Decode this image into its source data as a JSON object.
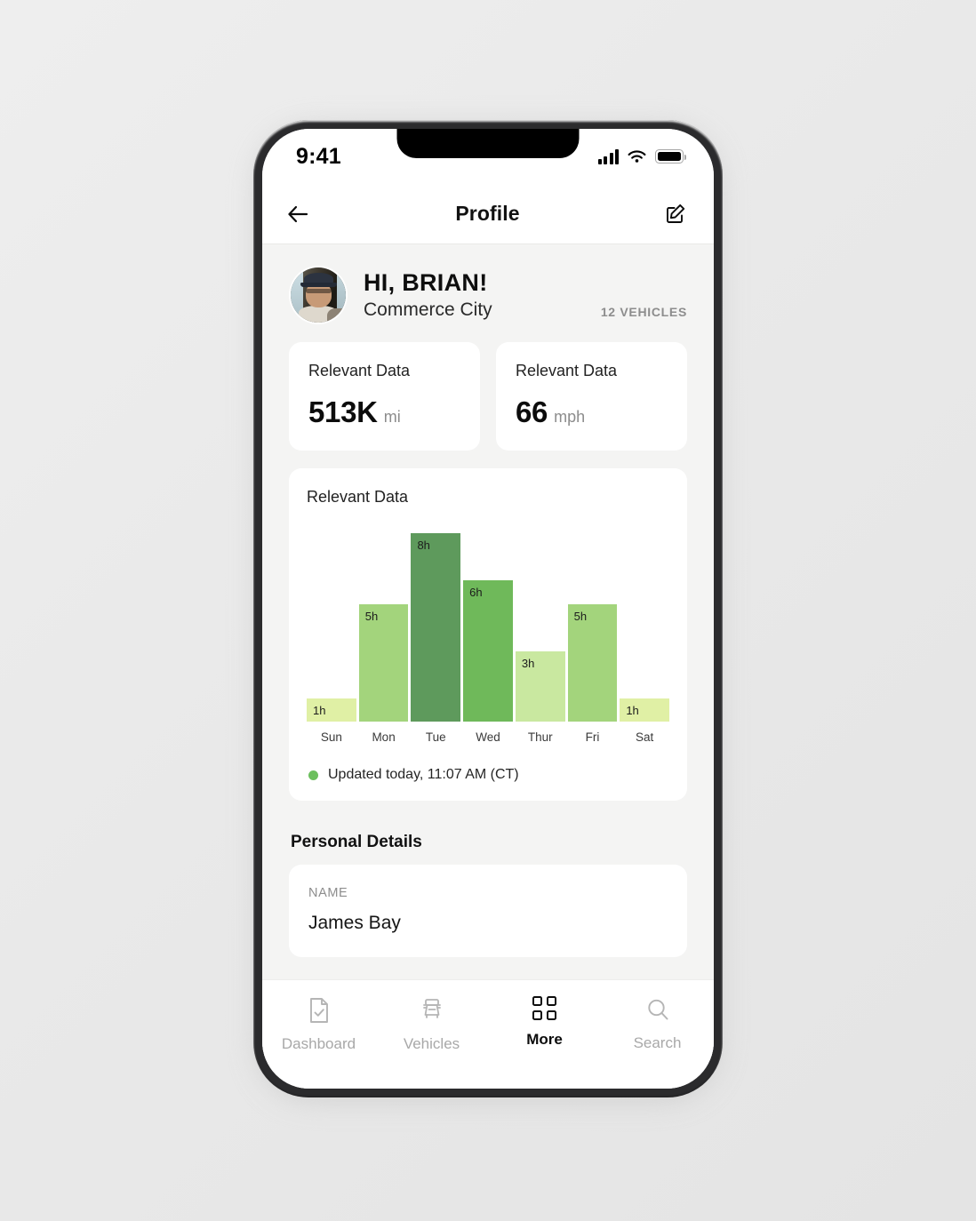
{
  "status_bar": {
    "time": "9:41",
    "cellular_icon": "signal-bars-icon",
    "wifi_icon": "wifi-icon",
    "battery_icon": "battery-full-icon"
  },
  "header": {
    "back_icon": "back-arrow-icon",
    "title": "Profile",
    "edit_icon": "edit-pencil-icon"
  },
  "profile": {
    "avatar_icon": "user-avatar-photo",
    "greeting": "HI, BRIAN!",
    "location": "Commerce City",
    "vehicle_count": "12 VEHICLES"
  },
  "stats": [
    {
      "label": "Relevant Data",
      "value": "513K",
      "unit": "mi"
    },
    {
      "label": "Relevant Data",
      "value": "66",
      "unit": "mph"
    }
  ],
  "chart_card": {
    "title": "Relevant Data",
    "status_dot_color": "#6cbf5e",
    "updated_text": "Updated today, 11:07 AM (CT)"
  },
  "chart_data": {
    "type": "bar",
    "title": "Relevant Data",
    "xlabel": "",
    "ylabel": "",
    "ylim": [
      0,
      8
    ],
    "grid": false,
    "legend": "none",
    "categories": [
      "Sun",
      "Mon",
      "Tue",
      "Wed",
      "Thur",
      "Fri",
      "Sat"
    ],
    "values": [
      1,
      5,
      8,
      6,
      3,
      5,
      1
    ],
    "value_labels": [
      "1h",
      "5h",
      "8h",
      "6h",
      "3h",
      "5h",
      "1h"
    ],
    "bar_colors": [
      "#e0f0a5",
      "#a3d47c",
      "#5e9a5c",
      "#6fb95a",
      "#c9e8a0",
      "#a3d47c",
      "#e0f0a5"
    ]
  },
  "personal_details": {
    "section_title": "Personal Details",
    "fields": [
      {
        "key": "NAME",
        "value": "James Bay"
      }
    ]
  },
  "tab_bar": {
    "items": [
      {
        "label": "Dashboard",
        "icon": "document-check-icon",
        "active": false
      },
      {
        "label": "Vehicles",
        "icon": "truck-icon",
        "active": false
      },
      {
        "label": "More",
        "icon": "grid-squares-icon",
        "active": true
      },
      {
        "label": "Search",
        "icon": "magnifier-icon",
        "active": false
      }
    ]
  }
}
